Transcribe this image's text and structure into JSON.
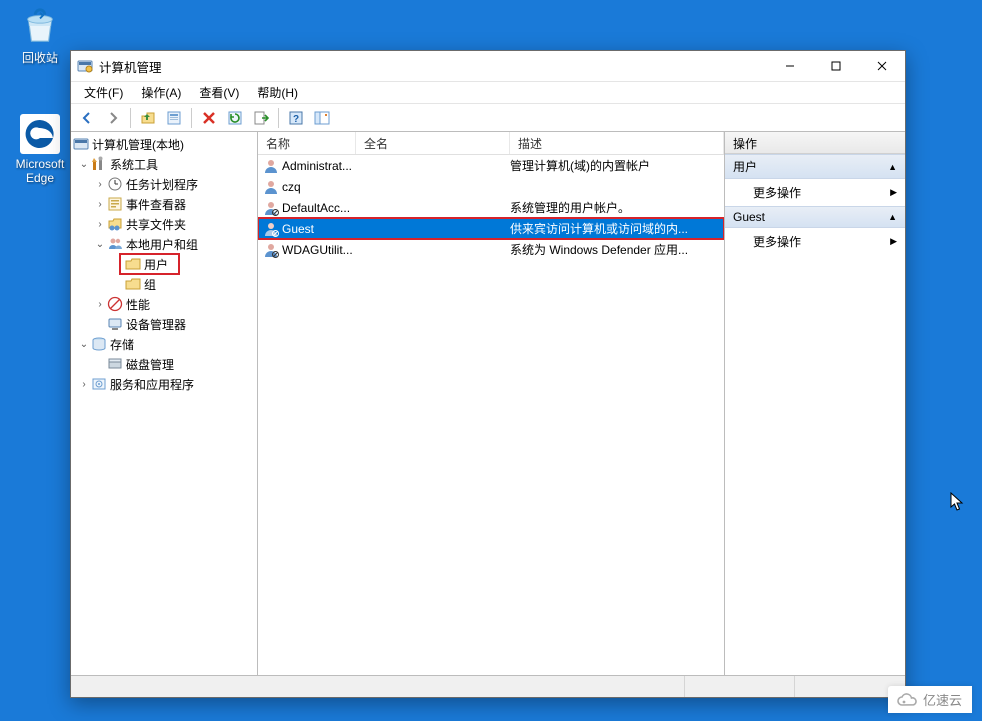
{
  "desktop": {
    "recycle_bin_label": "回收站",
    "edge_label": "Microsoft Edge"
  },
  "window": {
    "title": "计算机管理"
  },
  "menu": {
    "file": "文件(F)",
    "action": "操作(A)",
    "view": "查看(V)",
    "help": "帮助(H)"
  },
  "tree": {
    "root": "计算机管理(本地)",
    "system_tools": "系统工具",
    "task_scheduler": "任务计划程序",
    "event_viewer": "事件查看器",
    "shared_folders": "共享文件夹",
    "local_users_groups": "本地用户和组",
    "users_folder": "用户",
    "groups_folder": "组",
    "performance": "性能",
    "device_manager": "设备管理器",
    "storage": "存储",
    "disk_management": "磁盘管理",
    "services_apps": "服务和应用程序"
  },
  "columns": {
    "name": "名称",
    "full_name": "全名",
    "description": "描述"
  },
  "users": [
    {
      "name": "Administrat...",
      "full_name": "",
      "desc": "管理计算机(域)的内置帐户"
    },
    {
      "name": "czq",
      "full_name": "",
      "desc": ""
    },
    {
      "name": "DefaultAcc...",
      "full_name": "",
      "desc": "系统管理的用户帐户。"
    },
    {
      "name": "Guest",
      "full_name": "",
      "desc": "供来宾访问计算机或访问域的内..."
    },
    {
      "name": "WDAGUtilit...",
      "full_name": "",
      "desc": "系统为 Windows Defender 应用..."
    }
  ],
  "actions": {
    "panel_title": "操作",
    "section1_title": "用户",
    "section1_item": "更多操作",
    "section2_title": "Guest",
    "section2_item": "更多操作"
  },
  "watermark": {
    "text": "亿速云"
  }
}
